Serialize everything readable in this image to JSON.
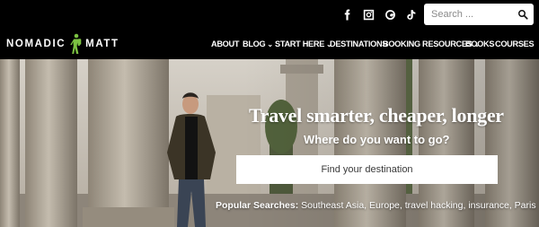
{
  "header": {
    "social": [
      {
        "name": "facebook-icon"
      },
      {
        "name": "instagram-icon"
      },
      {
        "name": "threads-icon"
      },
      {
        "name": "tiktok-icon"
      }
    ],
    "search": {
      "placeholder": "Search ..."
    }
  },
  "logo": {
    "left": "NOMADIC",
    "right": "MATT",
    "figure_color": "#7cc242"
  },
  "nav": {
    "about": "ABOUT",
    "blog": "BLOG",
    "start_here": "START HERE",
    "destinations": "DESTINATIONS",
    "booking_resources": "BOOKING RESOURCES",
    "books": "BOOKS",
    "courses": "COURSES",
    "chevron": "⌄"
  },
  "hero": {
    "headline": "Travel smarter, cheaper, longer",
    "subheadline": "Where do you want to go?",
    "destination_placeholder": "Find your destination",
    "popular_label": "Popular Searches:",
    "popular_items": "Southeast Asia, Europe, travel hacking, insurance, Paris"
  },
  "colors": {
    "bar": "#000000",
    "text": "#ffffff",
    "accent": "#7cc242"
  }
}
